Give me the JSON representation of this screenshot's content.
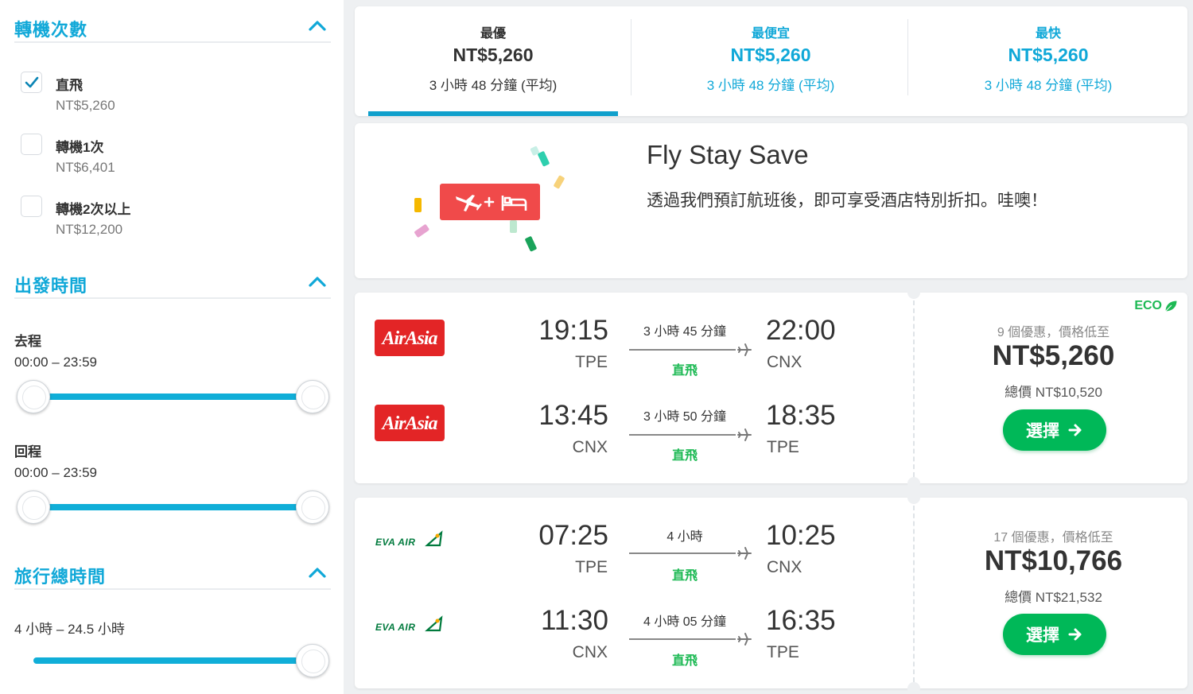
{
  "filters": {
    "stops": {
      "title": "轉機次數",
      "options": [
        {
          "label": "直飛",
          "price": "NT$5,260",
          "checked": true
        },
        {
          "label": "轉機1次",
          "price": "NT$6,401",
          "checked": false
        },
        {
          "label": "轉機2次以上",
          "price": "NT$12,200",
          "checked": false
        }
      ]
    },
    "departure": {
      "title": "出發時間",
      "outbound_label": "去程",
      "outbound_range": "00:00 – 23:59",
      "outbound_slider": {
        "min": 0,
        "max": 1
      },
      "return_label": "回程",
      "return_range": "00:00 – 23:59",
      "return_slider": {
        "min": 0,
        "max": 1
      }
    },
    "duration": {
      "title": "旅行總時間",
      "range": "4 小時 – 24.5 小時",
      "slider": {
        "min": 0,
        "max": 1
      }
    }
  },
  "sort_tabs": [
    {
      "name": "最優",
      "price": "NT$5,260",
      "duration": "3 小時 48 分鐘 (平均)",
      "active": true
    },
    {
      "name": "最便宜",
      "price": "NT$5,260",
      "duration": "3 小時 48 分鐘 (平均)",
      "active": false
    },
    {
      "name": "最快",
      "price": "NT$5,260",
      "duration": "3 小時 48 分鐘 (平均)",
      "active": false
    }
  ],
  "promo": {
    "title": "Fly Stay Save",
    "text": "透過我們預訂航班後，即可享受酒店特別折扣。哇噢！"
  },
  "results": [
    {
      "eco": "ECO",
      "airline_logo": "AirAsia",
      "legs": [
        {
          "dep_time": "19:15",
          "dep_airport": "TPE",
          "duration": "3 小時 45 分鐘",
          "stops": "直飛",
          "arr_time": "22:00",
          "arr_airport": "CNX"
        },
        {
          "dep_time": "13:45",
          "dep_airport": "CNX",
          "duration": "3 小時 50 分鐘",
          "stops": "直飛",
          "arr_time": "18:35",
          "arr_airport": "TPE"
        }
      ],
      "deals": "9 個優惠，價格低至",
      "price": "NT$5,260",
      "total": "總價 NT$10,520",
      "select_label": "選擇"
    },
    {
      "airline_logo": "EVA AIR",
      "legs": [
        {
          "dep_time": "07:25",
          "dep_airport": "TPE",
          "duration": "4 小時",
          "stops": "直飛",
          "arr_time": "10:25",
          "arr_airport": "CNX"
        },
        {
          "dep_time": "11:30",
          "dep_airport": "CNX",
          "duration": "4 小時 05 分鐘",
          "stops": "直飛",
          "arr_time": "16:35",
          "arr_airport": "TPE"
        }
      ],
      "deals": "17 個優惠，價格低至",
      "price": "NT$10,766",
      "total": "總價 NT$21,532",
      "select_label": "選擇"
    }
  ],
  "colors": {
    "accent": "#10a8d8",
    "active_tab_underline": "#10a0cc",
    "select_button": "#00b858",
    "direct_green": "#1db954",
    "airasia_red": "#e32526",
    "eva_green": "#007a3d",
    "promo_red": "#f04a4a"
  },
  "icons": {
    "checkbox": "check-icon",
    "collapse": "chevron-up-icon",
    "plane": "plane-icon",
    "arrow": "arrow-right-icon",
    "leaf": "leaf-icon",
    "promo": "plane-bed-icon"
  }
}
